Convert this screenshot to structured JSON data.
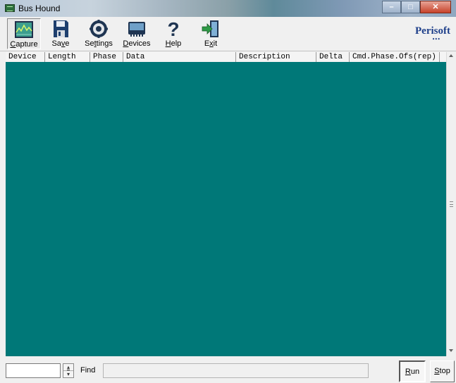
{
  "window": {
    "title": "Bus Hound"
  },
  "toolbar": {
    "capture": {
      "pre": "",
      "u": "C",
      "post": "apture"
    },
    "save": {
      "pre": "Sa",
      "u": "v",
      "post": "e"
    },
    "settings": {
      "pre": "Se",
      "u": "t",
      "post": "tings"
    },
    "devices": {
      "pre": "",
      "u": "D",
      "post": "evices"
    },
    "help": {
      "pre": "",
      "u": "H",
      "post": "elp"
    },
    "exit": {
      "pre": "E",
      "u": "x",
      "post": "it"
    },
    "brand": "Perisoft"
  },
  "columns": [
    "Device",
    "Length",
    "Phase",
    "Data",
    "Description",
    "Delta",
    "Cmd.Phase.Ofs(rep)"
  ],
  "status": {
    "find_label": "Find",
    "find_value": "",
    "run": {
      "pre": "",
      "u": "R",
      "post": "un"
    },
    "stop": {
      "pre": "",
      "u": "S",
      "post": "top"
    }
  },
  "colors": {
    "capture_area": "#007878",
    "brand": "#1e3f8a"
  },
  "icons": [
    "capture-icon",
    "save-icon",
    "settings-icon",
    "devices-icon",
    "help-icon",
    "exit-icon"
  ]
}
